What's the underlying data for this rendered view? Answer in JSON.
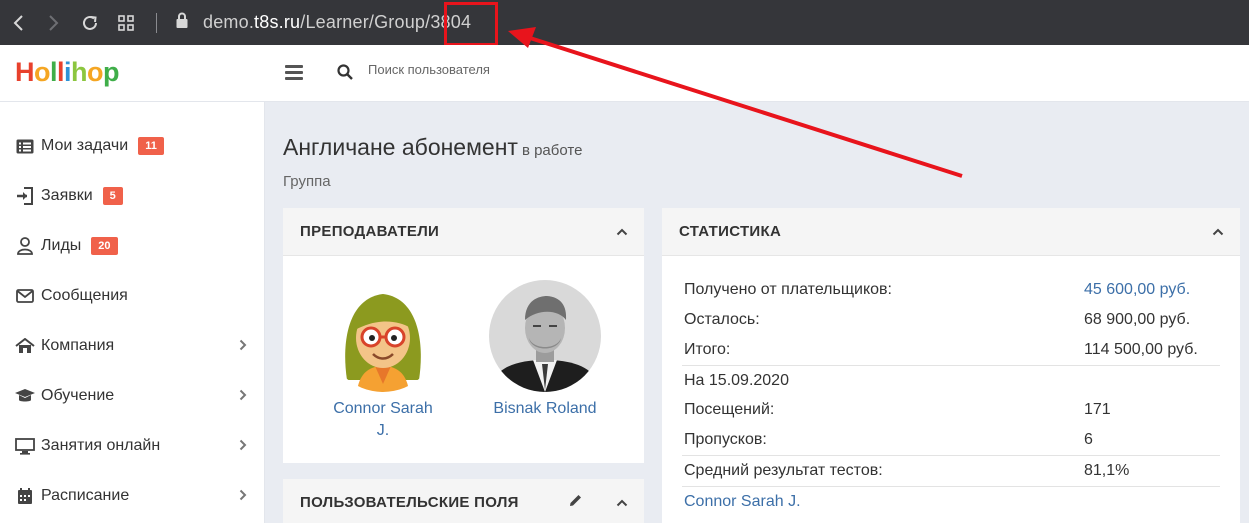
{
  "browser": {
    "url_prefix": "demo.",
    "url_host": "t8s.ru",
    "url_path": "/Learner/Group/",
    "url_id": "3804"
  },
  "header": {
    "logo": "Hollihop",
    "search_placeholder": "Поиск пользователя"
  },
  "sidebar": {
    "items": [
      {
        "label": "Мои задачи",
        "badge": "11",
        "icon": "tasks-list-icon"
      },
      {
        "label": "Заявки",
        "badge": "5",
        "icon": "sign-in-icon"
      },
      {
        "label": "Лиды",
        "badge": "20",
        "icon": "user-icon"
      },
      {
        "label": "Сообщения",
        "icon": "envelope-icon"
      },
      {
        "label": "Компания",
        "icon": "home-icon"
      },
      {
        "label": "Обучение",
        "icon": "graduation-cap-icon"
      },
      {
        "label": "Занятия онлайн",
        "icon": "monitor-icon"
      },
      {
        "label": "Расписание",
        "icon": "calendar-icon"
      }
    ]
  },
  "page": {
    "title": "Англичане абонемент",
    "status": "в работе",
    "subtitle": "Группа"
  },
  "teachers_panel": {
    "title": "ПРЕПОДАВАТЕЛИ",
    "teachers": [
      {
        "name_line1": "Connor Sarah",
        "name_line2": "J."
      },
      {
        "name_line1": "Bisnak Roland",
        "name_line2": ""
      }
    ]
  },
  "custom_fields_panel": {
    "title": "ПОЛЬЗОВАТЕЛЬСКИЕ ПОЛЯ"
  },
  "stats_panel": {
    "title": "СТАТИСТИКА",
    "rows": [
      {
        "key": "Получено от плательщиков:",
        "value": "45 600,00 руб."
      },
      {
        "key": "Осталось:",
        "value": "68 900,00 руб."
      },
      {
        "key": "Итого:",
        "value": "114 500,00 руб."
      },
      {
        "key": "На 15.09.2020",
        "value": ""
      },
      {
        "key": "Посещений:",
        "value": "171"
      },
      {
        "key": "Пропусков:",
        "value": "6"
      },
      {
        "key": "Средний результат тестов:",
        "value": "81,1%"
      },
      {
        "key": "Connor Sarah J.",
        "value": ""
      }
    ]
  },
  "colors": {
    "browser_bar": "#35363a",
    "annotation_red": "#e8141c",
    "badge": "#f0614a",
    "link": "#3c6fa8"
  }
}
